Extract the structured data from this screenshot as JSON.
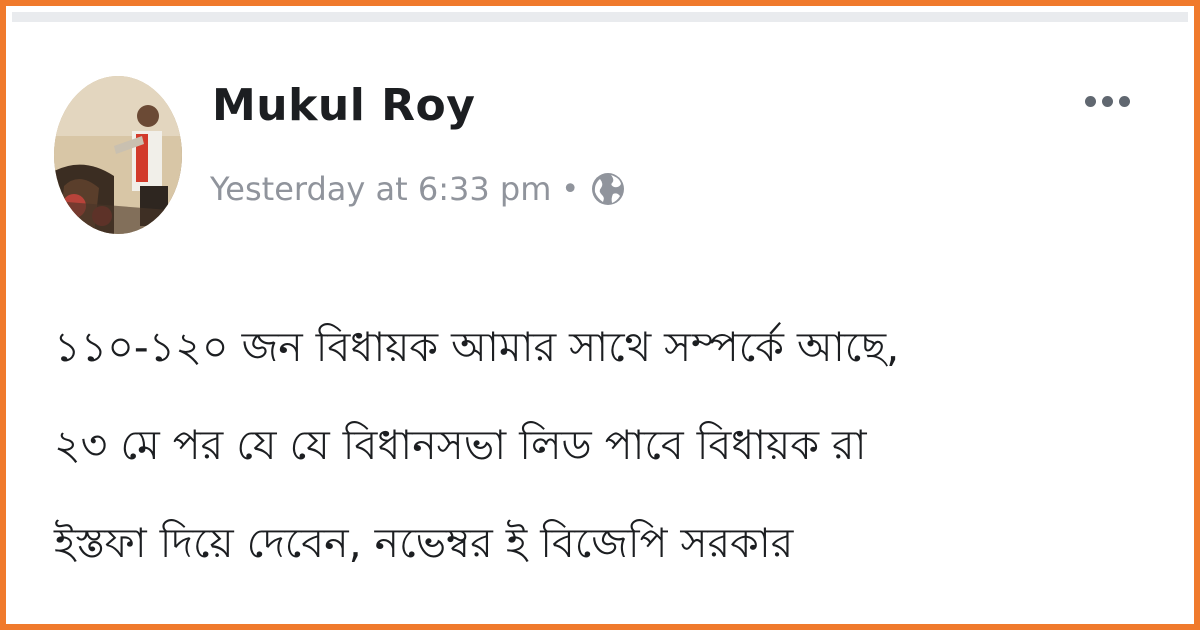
{
  "post": {
    "author_name": "Mukul Roy",
    "timestamp": "Yesterday at 6:33 pm",
    "separator": "•",
    "privacy_icon": "globe-icon",
    "more_icon": "more-options-icon",
    "body_lines": [
      "১১০-১২০ জন বিধায়ক আমার সাথে  সম্পর্কে আছে,",
      "২৩ মে পর যে যে বিধানসভা লিড পাবে বিধায়ক রা",
      "ইস্তফা দিয়ে দেবেন, নভেম্বর ই বিজেপি সরকার"
    ]
  },
  "colors": {
    "frame_border": "#f07a2c",
    "name_text": "#1c1e21",
    "meta_text": "#90949c",
    "body_text": "#1c1e21"
  }
}
